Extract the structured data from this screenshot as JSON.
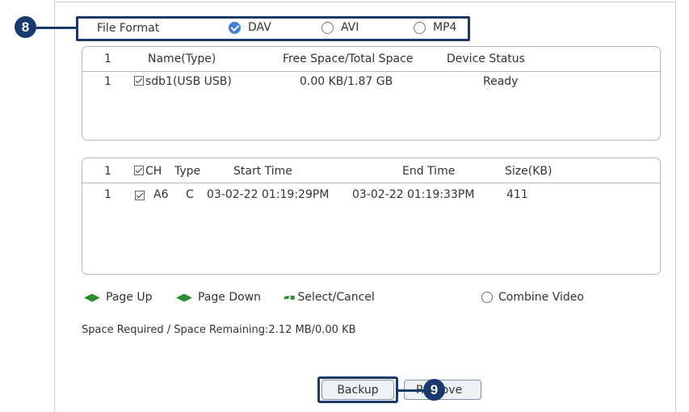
{
  "callouts": {
    "format": "8",
    "backup": "9"
  },
  "file_format": {
    "label": "File Format",
    "options": [
      {
        "label": "DAV",
        "checked": true
      },
      {
        "label": "AVI",
        "checked": false
      },
      {
        "label": "MP4",
        "checked": false
      }
    ]
  },
  "device_table": {
    "headers": [
      "1",
      "Name(Type)",
      "Free Space/Total Space",
      "Device Status"
    ],
    "rows": [
      {
        "num": "1",
        "name": "sdb1(USB USB)",
        "space": "0.00 KB/1.87 GB",
        "status": "Ready",
        "checked": true
      }
    ]
  },
  "file_table": {
    "headers": [
      "1",
      "CH",
      "Type",
      "Start Time",
      "End Time",
      "Size(KB)"
    ],
    "rows": [
      {
        "num": "1",
        "ch": "A6",
        "type": "C",
        "start": "03-02-22 01:19:29PM",
        "end": "03-02-22 01:19:33PM",
        "size": "411",
        "checked": true
      }
    ]
  },
  "controls": {
    "page_up": "Page Up",
    "page_down": "Page Down",
    "select_cancel": "Select/Cancel",
    "combine_video": "Combine Video",
    "icons": {
      "page_up": "page-up-icon",
      "page_down": "page-down-icon",
      "select_cancel": "select-cancel-icon"
    }
  },
  "space_text": "Space Required / Space Remaining:2.12 MB/0.00 KB",
  "buttons": {
    "backup": "Backup",
    "remove_prefix": "R",
    "remove_suffix": "ove"
  },
  "colors": {
    "callout": "#1a3a6e",
    "radio_checked": "#3f7fd4",
    "icon_green": "#2e8b2e"
  }
}
